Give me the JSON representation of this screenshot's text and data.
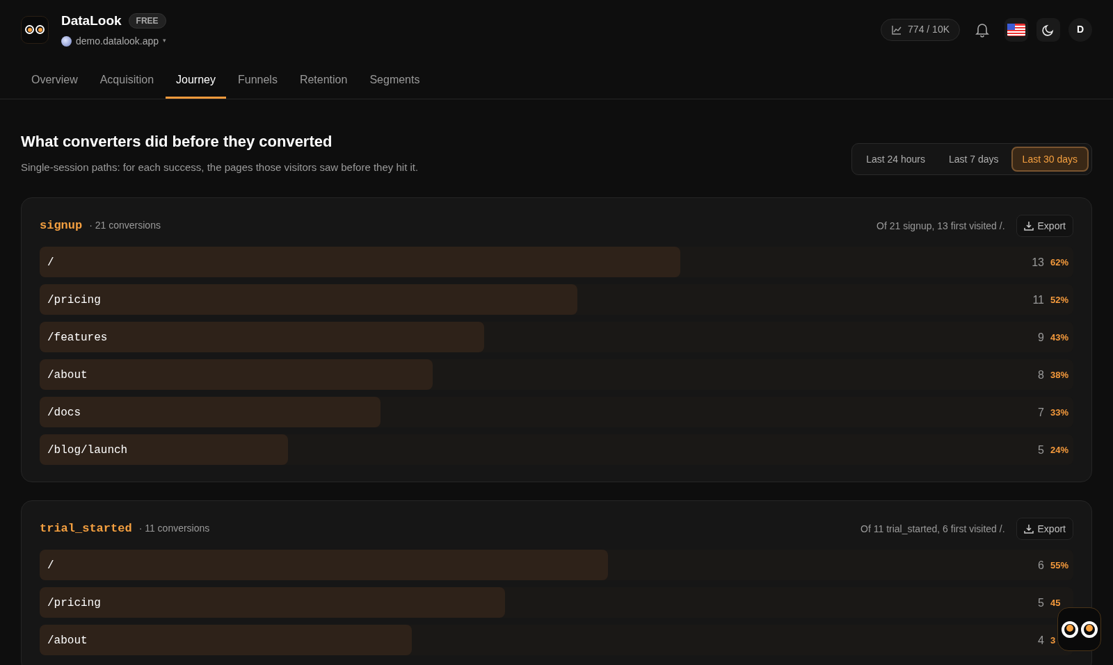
{
  "brand": {
    "name": "DataLook",
    "plan": "FREE",
    "site": "demo.datalook.app",
    "site_caret": "▾"
  },
  "usage": "774 / 10K",
  "avatar": "D",
  "tabs": [
    {
      "label": "Overview",
      "selected": false
    },
    {
      "label": "Acquisition",
      "selected": false
    },
    {
      "label": "Journey",
      "selected": true
    },
    {
      "label": "Funnels",
      "selected": false
    },
    {
      "label": "Retention",
      "selected": false
    },
    {
      "label": "Segments",
      "selected": false
    }
  ],
  "heading": "What converters did before they converted",
  "subheading": "Single-session paths: for each success, the pages those visitors saw before they hit it.",
  "ranges": [
    {
      "label": "Last 24 hours",
      "selected": false
    },
    {
      "label": "Last 7 days",
      "selected": false
    },
    {
      "label": "Last 30 days",
      "selected": true
    }
  ],
  "goals": [
    {
      "event": "signup",
      "count": "· 21 conversions",
      "summary": "Of 21 signup, 13 first visited /.",
      "export": "Export",
      "paths": [
        {
          "path": "/",
          "count": "13",
          "percent": "62%",
          "level": 0.62
        },
        {
          "path": "/pricing",
          "count": "11",
          "percent": "52%",
          "level": 0.52
        },
        {
          "path": "/features",
          "count": "9",
          "percent": "43%",
          "level": 0.43
        },
        {
          "path": "/about",
          "count": "8",
          "percent": "38%",
          "level": 0.38
        },
        {
          "path": "/docs",
          "count": "7",
          "percent": "33%",
          "level": 0.33
        },
        {
          "path": "/blog/launch",
          "count": "5",
          "percent": "24%",
          "level": 0.24
        }
      ]
    },
    {
      "event": "trial_started",
      "count": "· 11 conversions",
      "summary": "Of 11 trial_started, 6 first visited /.",
      "export": "Export",
      "paths": [
        {
          "path": "/",
          "count": "6",
          "percent": "55%",
          "level": 0.55
        },
        {
          "path": "/pricing",
          "count": "5",
          "percent": "45",
          "level": 0.45
        },
        {
          "path": "/about",
          "count": "4",
          "percent": "3",
          "level": 0.36
        }
      ]
    }
  ]
}
